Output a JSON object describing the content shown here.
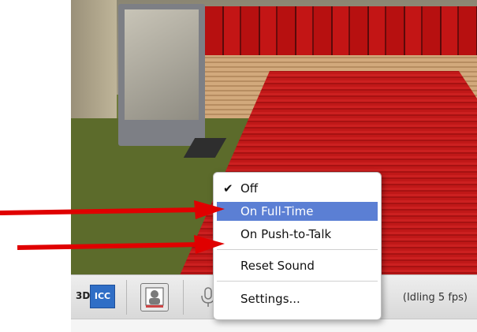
{
  "menu": {
    "items": [
      {
        "label": "Off",
        "checked": true,
        "selected": false
      },
      {
        "label": "On Full-Time",
        "checked": false,
        "selected": true
      },
      {
        "label": "On Push-to-Talk",
        "checked": false,
        "selected": false
      },
      {
        "label": "Reset Sound",
        "checked": false,
        "selected": false
      },
      {
        "label": "Settings...",
        "checked": false,
        "selected": false
      }
    ],
    "check_glyph": "✔"
  },
  "toolbar": {
    "logo_3d": "3D",
    "logo_icc": "ICC",
    "status": "(Idling 5 fps)"
  },
  "colors": {
    "selected_item": "#5b7fd4",
    "arrow": "#e00000",
    "carpet": "#c01818"
  },
  "icons": [
    "3dicc-logo-icon",
    "avatar-icon",
    "microphone-icon",
    "arrow-right-icon"
  ]
}
